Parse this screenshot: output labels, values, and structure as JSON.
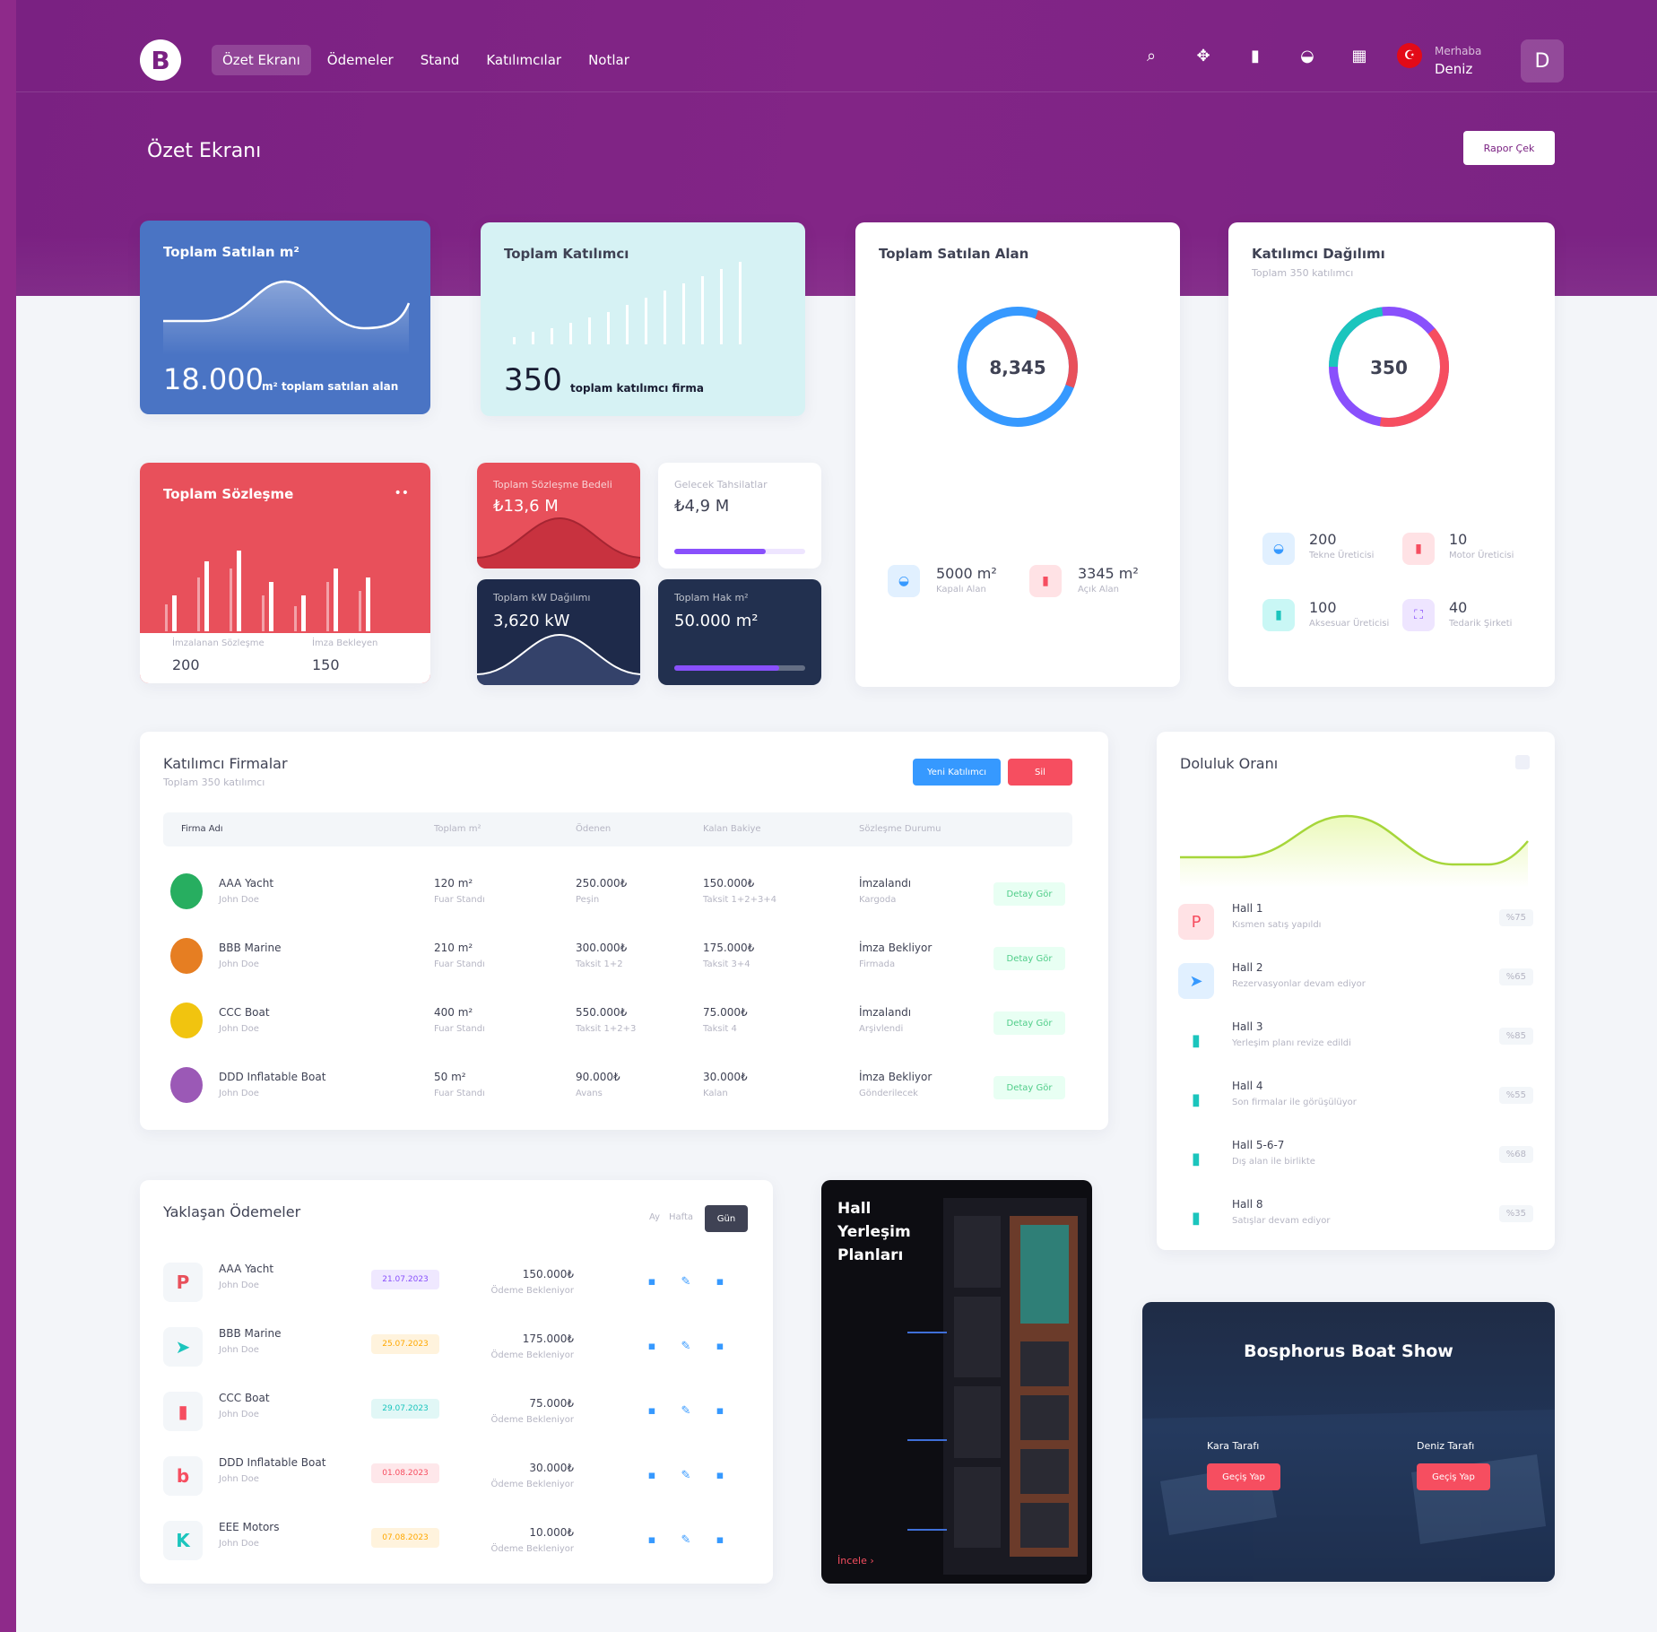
{
  "nav": {
    "items": [
      "Özet Ekranı",
      "Ödemeler",
      "Stand",
      "Katılımcılar",
      "Notlar"
    ],
    "active": 0
  },
  "user": {
    "greeting": "Merhaba",
    "name": "Deniz",
    "initial": "D"
  },
  "page": {
    "title": "Özet Ekranı",
    "report_button": "Rapor Çek"
  },
  "toolbar_icons": [
    "search-icon",
    "share-icon",
    "chart-icon",
    "basket-icon",
    "grid-icon",
    "turkish-flag-icon"
  ],
  "card_m2": {
    "title": "Toplam Satılan m²",
    "value": "18.000",
    "caption": "m² toplam satılan alan",
    "color": "#4a74c4"
  },
  "card_participants": {
    "title": "Toplam Katılımcı",
    "value": "350",
    "caption": "toplam katılımcı firma"
  },
  "card_area": {
    "title": "Toplam Satılan Alan",
    "center": "8,345",
    "stats": [
      {
        "value": "5000 m²",
        "label": "Kapalı Alan"
      },
      {
        "value": "3345 m²",
        "label": "Açık Alan"
      }
    ]
  },
  "card_dist": {
    "title": "Katılımcı Dağılımı",
    "subtitle": "Toplam 350 katılımcı",
    "center": "350",
    "stats": [
      {
        "value": "200",
        "label": "Tekne Üreticisi"
      },
      {
        "value": "10",
        "label": "Motor Üreticisi"
      },
      {
        "value": "100",
        "label": "Aksesuar Üreticisi"
      },
      {
        "value": "40",
        "label": "Tedarik Şirketi"
      }
    ]
  },
  "card_contract": {
    "title": "Toplam Sözleşme",
    "menu": "••",
    "stats": [
      {
        "label": "İmzalanan Sözleşme",
        "value": "200"
      },
      {
        "label": "İmza Bekleyen",
        "value": "150"
      }
    ],
    "color": "#e8505b"
  },
  "mini": {
    "contract_fee": {
      "label": "Toplam Sözleşme Bedeli",
      "value": "₺13,6 M"
    },
    "future": {
      "label": "Gelecek Tahsilatlar",
      "value": "₺4,9 M",
      "progress": 0.7
    },
    "kw": {
      "label": "Toplam kW Dağılımı",
      "value": "3,620 kW"
    },
    "right": {
      "label": "Toplam Hak m²",
      "value": "50.000 m²",
      "progress": 0.8
    }
  },
  "firms": {
    "title": "Katılımcı Firmalar",
    "subtitle": "Toplam 350 katılımcı",
    "btn_new": "Yeni Katılımcı",
    "btn_delete": "Sil",
    "columns": [
      "Firma Adı",
      "Toplam m²",
      "Ödenen",
      "Kalan Bakiye",
      "Sözleşme Durumu"
    ],
    "detail_label": "Detay Gör",
    "rows": [
      {
        "name": "AAA Yacht",
        "contact": "John Doe",
        "m2": "120 m²",
        "m2_sub": "Fuar Standı",
        "paid": "250.000₺",
        "paid_sub": "Peşin",
        "rem": "150.000₺",
        "rem_sub": "Taksit 1+2+3+4",
        "status": "İmzalandı",
        "status_sub": "Kargoda"
      },
      {
        "name": "BBB Marine",
        "contact": "John Doe",
        "m2": "210 m²",
        "m2_sub": "Fuar Standı",
        "paid": "300.000₺",
        "paid_sub": "Taksit 1+2",
        "rem": "175.000₺",
        "rem_sub": "Taksit 3+4",
        "status": "İmza Bekliyor",
        "status_sub": "Firmada"
      },
      {
        "name": "CCC Boat",
        "contact": "John Doe",
        "m2": "400 m²",
        "m2_sub": "Fuar Standı",
        "paid": "550.000₺",
        "paid_sub": "Taksit 1+2+3",
        "rem": "75.000₺",
        "rem_sub": "Taksit 4",
        "status": "İmzalandı",
        "status_sub": "Arşivlendi"
      },
      {
        "name": "DDD Inflatable Boat",
        "contact": "John Doe",
        "m2": "50 m²",
        "m2_sub": "Fuar Standı",
        "paid": "90.000₺",
        "paid_sub": "Avans",
        "rem": "30.000₺",
        "rem_sub": "Kalan",
        "status": "İmza Bekliyor",
        "status_sub": "Gönderilecek"
      }
    ]
  },
  "occupancy": {
    "title": "Doluluk Oranı",
    "halls": [
      {
        "name": "Hall 1",
        "desc": "Kısmen satış yapıldı",
        "pct": "%75"
      },
      {
        "name": "Hall 2",
        "desc": "Rezervasyonlar devam ediyor",
        "pct": "%65"
      },
      {
        "name": "Hall 3",
        "desc": "Yerleşim planı revize edildi",
        "pct": "%85"
      },
      {
        "name": "Hall 4",
        "desc": "Son firmalar ile görüşülüyor",
        "pct": "%55"
      },
      {
        "name": "Hall 5-6-7",
        "desc": "Dış alan ile birlikte",
        "pct": "%68"
      },
      {
        "name": "Hall 8",
        "desc": "Satışlar devam ediyor",
        "pct": "%35"
      }
    ]
  },
  "payments": {
    "title": "Yaklaşan Ödemeler",
    "filters": [
      "Ay",
      "Hafta",
      "Gün"
    ],
    "active": 2,
    "rows": [
      {
        "name": "AAA Yacht",
        "contact": "John Doe",
        "date": "21.07.2023",
        "date_color": "#8950fc",
        "amount": "150.000₺",
        "note": "Ödeme Bekleniyor",
        "logo": "P",
        "logo_color": "#e8505b"
      },
      {
        "name": "BBB Marine",
        "contact": "John Doe",
        "date": "25.07.2023",
        "date_color": "#ffa800",
        "amount": "175.000₺",
        "note": "Ödeme Bekleniyor",
        "logo": "➤",
        "logo_color": "#1bc5bd"
      },
      {
        "name": "CCC Boat",
        "contact": "John Doe",
        "date": "29.07.2023",
        "date_color": "#1bc5bd",
        "amount": "75.000₺",
        "note": "Ödeme Bekleniyor",
        "logo": "▮",
        "logo_color": "#f64e60"
      },
      {
        "name": "DDD Inflatable Boat",
        "contact": "John Doe",
        "date": "01.08.2023",
        "date_color": "#f64e60",
        "amount": "30.000₺",
        "note": "Ödeme Bekleniyor",
        "logo": "b",
        "logo_color": "#f64e60"
      },
      {
        "name": "EEE Motors",
        "contact": "John Doe",
        "date": "07.08.2023",
        "date_color": "#ffa800",
        "amount": "10.000₺",
        "note": "Ödeme Bekleniyor",
        "logo": "K",
        "logo_color": "#1bc5bd"
      }
    ]
  },
  "hall_plan": {
    "title_lines": [
      "Hall",
      "Yerleşim",
      "Planları"
    ],
    "link": "İncele"
  },
  "boat_show": {
    "title": "Bosphorus Boat Show",
    "left_label": "Kara Tarafı",
    "right_label": "Deniz Tarafı",
    "btn": "Geçiş Yap"
  }
}
